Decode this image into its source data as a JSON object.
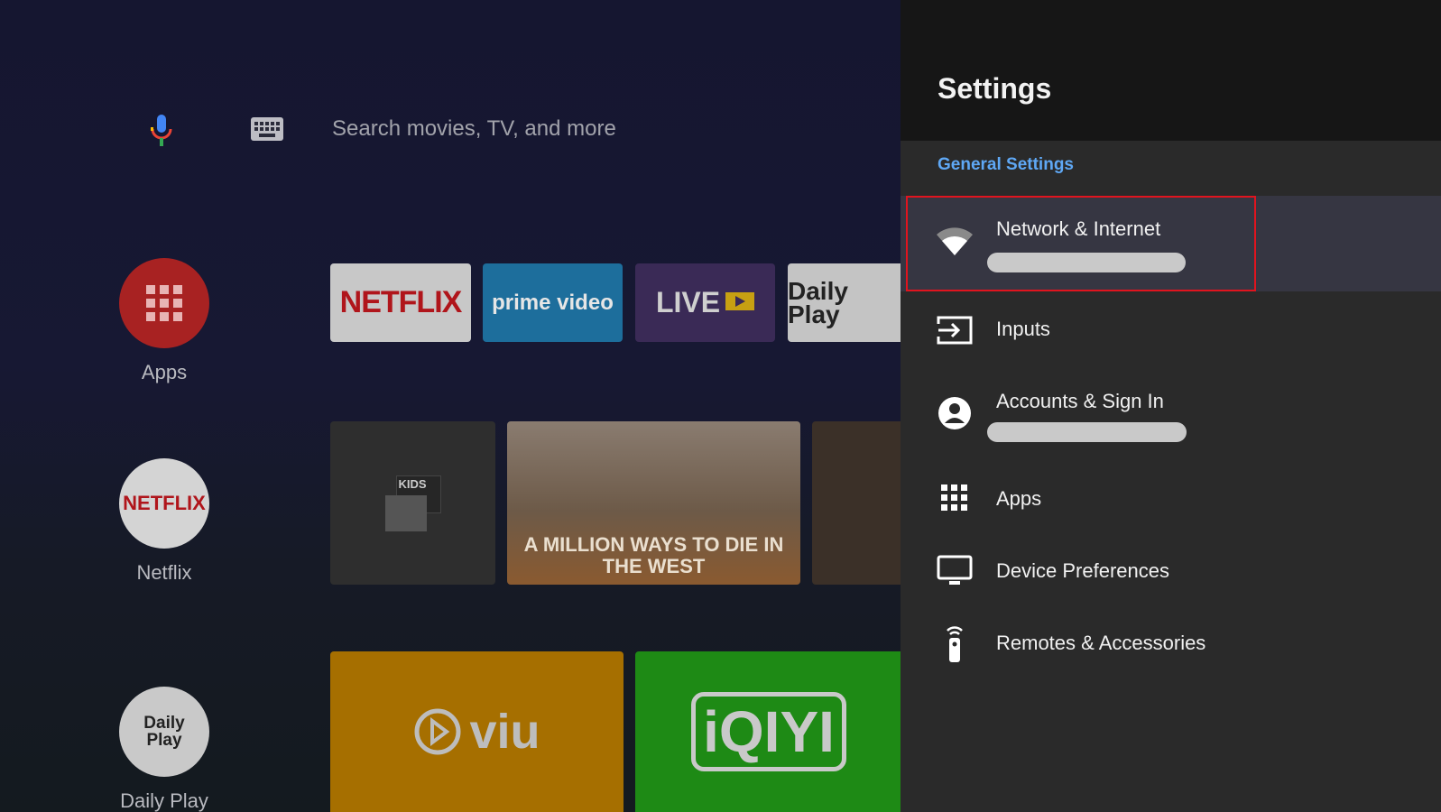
{
  "home": {
    "search": {
      "placeholder": "Search movies, TV, and more"
    },
    "icons": {
      "mic": "mic-icon",
      "keyboard": "keyboard-icon"
    },
    "rail": [
      {
        "label": "Apps",
        "color": "#b32424"
      },
      {
        "label": "Netflix",
        "color": "#d9d9d9"
      },
      {
        "label": "Daily Play",
        "color": "#cfcfcf"
      }
    ],
    "apps_row": [
      {
        "name": "NETFLIX",
        "bg": "#c8c8c8",
        "fg": "#b0151b"
      },
      {
        "name": "prime video",
        "bg": "#1d6e9c",
        "fg": "#e8e8e8"
      },
      {
        "name": "LIVE",
        "bg": "#3a2a56",
        "fg": "#cfcfcf"
      },
      {
        "name": "Daily Play",
        "bg": "#c4c4c4",
        "fg": "#222222"
      }
    ],
    "content_row": [
      {
        "name": "KIDS",
        "bg": "#2e2e2e"
      },
      {
        "name": "A MILLION WAYS TO DIE IN THE WEST",
        "bg": "#6a5646"
      },
      {
        "name": "",
        "bg": "#3b3028"
      }
    ],
    "bottom_row": [
      {
        "name": "viu",
        "bg": "#a66f00",
        "fg": "#bdbdbd"
      },
      {
        "name": "iQIYI",
        "bg": "#1e8a15",
        "fg": "#c9c9c9"
      }
    ]
  },
  "settings": {
    "title": "Settings",
    "section": "General Settings",
    "items": [
      {
        "label": "Network & Internet",
        "icon": "wifi-icon",
        "has_sub": true,
        "focused": true
      },
      {
        "label": "Inputs",
        "icon": "input-icon"
      },
      {
        "label": "Accounts & Sign In",
        "icon": "account-icon",
        "has_sub": true
      },
      {
        "label": "Apps",
        "icon": "apps-grid-icon"
      },
      {
        "label": "Device Preferences",
        "icon": "tv-icon"
      },
      {
        "label": "Remotes & Accessories",
        "icon": "remote-icon"
      }
    ],
    "colors": {
      "accent": "#5fa8f5",
      "focus": "#e0141e"
    }
  }
}
